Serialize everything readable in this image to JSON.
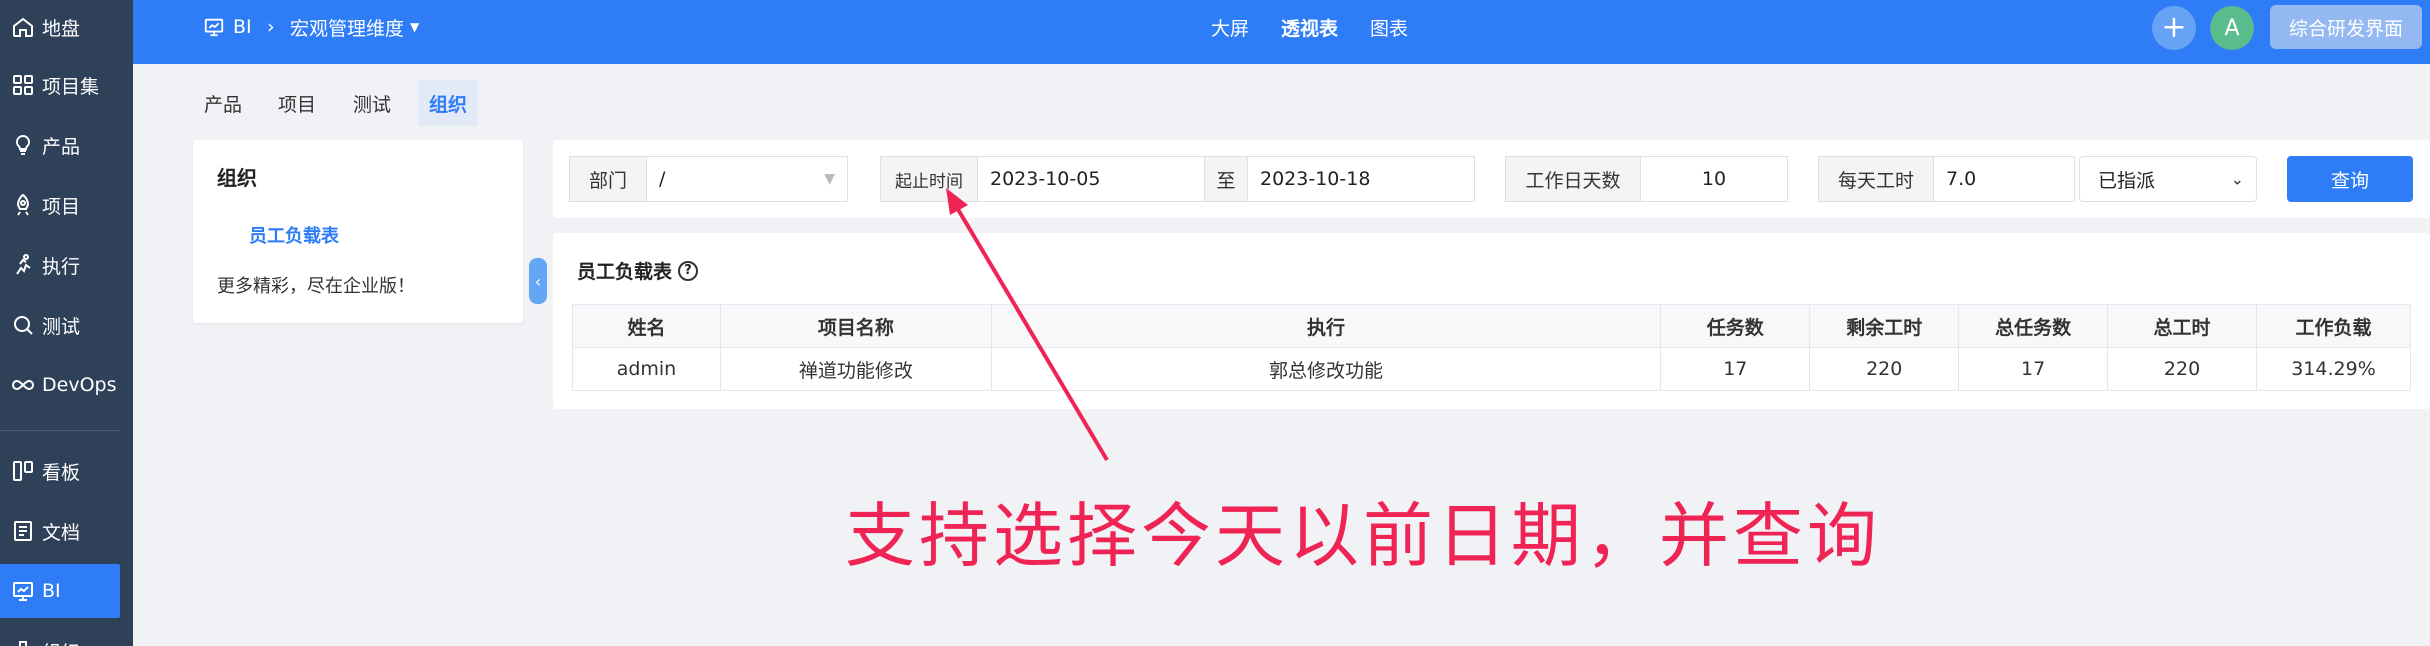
{
  "sidebar": {
    "items": [
      {
        "label": "地盘",
        "icon": "home-icon"
      },
      {
        "label": "项目集",
        "icon": "grid-icon"
      },
      {
        "label": "产品",
        "icon": "bulb-icon"
      },
      {
        "label": "项目",
        "icon": "rocket-icon"
      },
      {
        "label": "执行",
        "icon": "run-icon"
      },
      {
        "label": "测试",
        "icon": "search-icon"
      },
      {
        "label": "DevOps",
        "icon": "infinity-icon"
      },
      {
        "label": "看板",
        "icon": "kanban-icon"
      },
      {
        "label": "文档",
        "icon": "doc-icon"
      },
      {
        "label": "BI",
        "icon": "monitor-icon"
      },
      {
        "label": "组织",
        "icon": "org-icon"
      }
    ],
    "active_index": 9
  },
  "header": {
    "crumb_bi": "BI",
    "crumb_dimension": "宏观管理维度",
    "tabs": [
      {
        "label": "大屏"
      },
      {
        "label": "透视表"
      },
      {
        "label": "图表"
      }
    ],
    "avatar_letter": "A",
    "workspace_button": "综合研发界面",
    "colors": {
      "primary": "#2e7cf6",
      "sidebar": "#2f4159",
      "avatar": "#5bbd8d"
    }
  },
  "subtabs": [
    {
      "label": "产品"
    },
    {
      "label": "项目"
    },
    {
      "label": "测试"
    },
    {
      "label": "组织"
    }
  ],
  "left_panel": {
    "title": "组织",
    "item": "员工负载表",
    "note": "更多精彩，尽在企业版！"
  },
  "filter": {
    "dept_label": "部门",
    "dept_value": "/",
    "time_label": "起止时间",
    "start_date": "2023-10-05",
    "to_label": "至",
    "end_date": "2023-10-18",
    "workdays_label": "工作日天数",
    "workdays_value": "10",
    "hours_label": "每天工时",
    "hours_value": "7.0",
    "assign_value": "已指派",
    "query_button": "查询"
  },
  "table": {
    "title": "员工负载表",
    "columns": [
      "姓名",
      "项目名称",
      "执行",
      "任务数",
      "剩余工时",
      "总任务数",
      "总工时",
      "工作负载"
    ],
    "rows": [
      [
        "admin",
        "禅道功能修改",
        "郭总修改功能",
        "17",
        "220",
        "17",
        "220",
        "314.29%"
      ]
    ]
  },
  "annotation": {
    "text": "支持选择今天以前日期，并查询",
    "color": "#ef2454"
  }
}
